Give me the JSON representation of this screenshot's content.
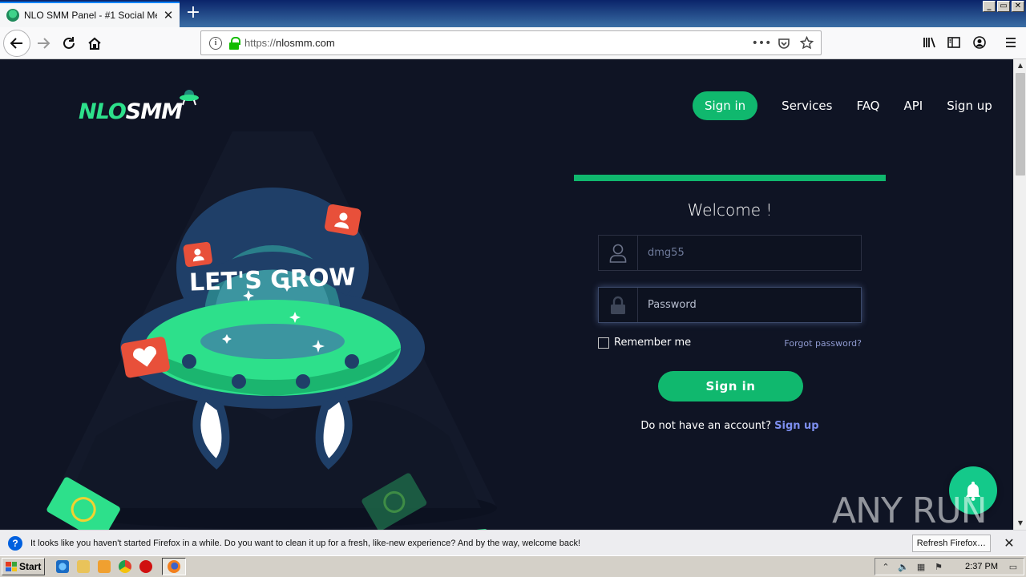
{
  "browser": {
    "tab_title": "NLO SMM Panel - #1 Social Media M",
    "tab_close": "✕",
    "new_tab": "+",
    "url_protocol": "https://",
    "url_host": "nlosmm.com",
    "page_actions": "•••",
    "window_controls": [
      "_",
      "▭",
      "✕"
    ]
  },
  "site": {
    "logo_primary": "NLO",
    "logo_secondary": "SMM",
    "nav": [
      {
        "label": "Sign in",
        "active": true
      },
      {
        "label": "Services"
      },
      {
        "label": "FAQ"
      },
      {
        "label": "API"
      },
      {
        "label": "Sign up"
      }
    ],
    "hero_text": "LET'S GROW",
    "brand_color": "#10b86e"
  },
  "login": {
    "welcome": "Welcome !",
    "username_value": "dmg55",
    "password_placeholder": "Password",
    "remember_label": "Remember me",
    "forgot_label": "Forgot password?",
    "submit_label": "Sign in",
    "no_account_text": "Do not have an account?",
    "signup_link": "Sign up"
  },
  "watermark": "ANY RUN",
  "notification": {
    "message": "It looks like you haven't started Firefox in a while. Do you want to clean it up for a fresh, like-new experience? And by the way, welcome back!",
    "button": "Refresh Firefox…",
    "close": "✕"
  },
  "taskbar": {
    "start_label": "Start",
    "clock": "2:37 PM"
  }
}
